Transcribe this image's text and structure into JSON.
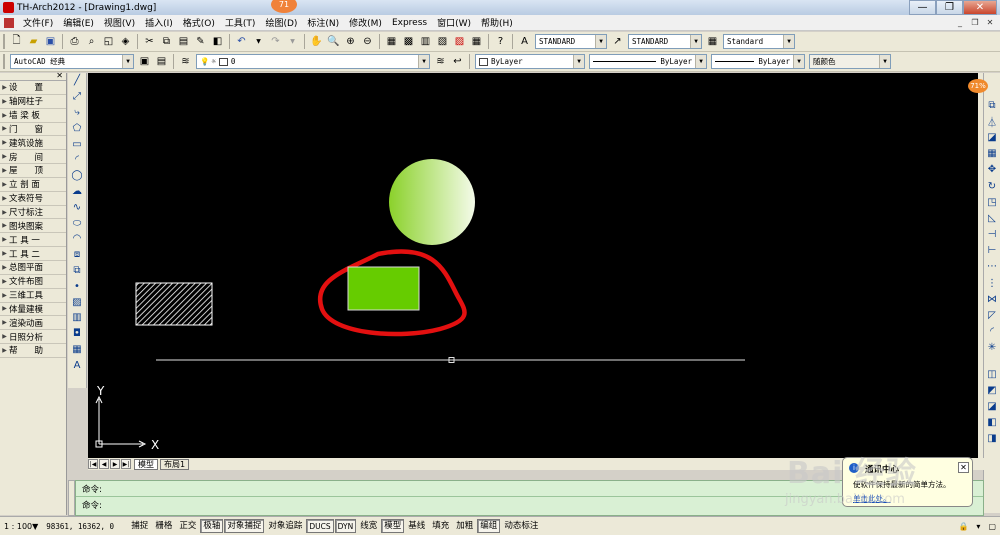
{
  "window": {
    "title": "TH-Arch2012 - [Drawing1.dwg]",
    "notify_count": "71",
    "minimize": "—",
    "maximize": "❐",
    "close": "✕"
  },
  "menu": [
    "文件(F)",
    "编辑(E)",
    "视图(V)",
    "插入(I)",
    "格式(O)",
    "工具(T)",
    "绘图(D)",
    "标注(N)",
    "修改(M)",
    "Express",
    "窗口(W)",
    "帮助(H)"
  ],
  "mdi": {
    "minimize": "_",
    "restore": "❐",
    "close": "✕"
  },
  "toolbar1": {
    "text_style": "STANDARD",
    "dim_style": "STANDARD",
    "table_style": "Standard"
  },
  "toolbar2": {
    "workspace": "AutoCAD 经典",
    "layer": "0",
    "color": "ByLayer",
    "linetype": "ByLayer",
    "lineweight": "ByLayer",
    "plotstyle": "随颜色"
  },
  "tarch_menu": [
    "设　　置",
    "轴网柱子",
    "墙 梁 板",
    "门　　窗",
    "建筑设施",
    "房　　间",
    "屋　　顶",
    "立 剖 面",
    "文表符号",
    "尺寸标注",
    "图块图案",
    "工 具 一",
    "工 具 二",
    "总图平面",
    "文件布图",
    "三维工具",
    "体量建模",
    "渲染动画",
    "日照分析",
    "帮　　助"
  ],
  "canvas": {
    "ucs_y": "Y",
    "ucs_x": "X",
    "colors": {
      "background": "#000000",
      "rect": "#66cc00",
      "annotation": "#e31010",
      "circle_light": "#f4fbe9",
      "circle_dark": "#8bd12b"
    }
  },
  "tabs": {
    "model": "模型",
    "layout": "布局1"
  },
  "command": {
    "line1": "命令:",
    "line2": "命令:"
  },
  "status": {
    "scale": "1 : 100",
    "coords": "98361,  16362, 0",
    "buttons": [
      {
        "label": "捕捉",
        "on": false
      },
      {
        "label": "栅格",
        "on": false
      },
      {
        "label": "正交",
        "on": false
      },
      {
        "label": "极轴",
        "on": true
      },
      {
        "label": "对象捕捉",
        "on": true
      },
      {
        "label": "对象追踪",
        "on": false
      },
      {
        "label": "DUCS",
        "on": true
      },
      {
        "label": "DYN",
        "on": true
      },
      {
        "label": "线宽",
        "on": false
      },
      {
        "label": "模型",
        "on": true
      },
      {
        "label": "基线",
        "on": false
      },
      {
        "label": "填充",
        "on": false
      },
      {
        "label": "加粗",
        "on": false
      },
      {
        "label": "编组",
        "on": true
      },
      {
        "label": "动态标注",
        "on": false
      }
    ]
  },
  "balloon": {
    "title": "通讯中心",
    "text": "使软件保持最新的简单方法。",
    "link": "单击此处。"
  },
  "side_badge": "71%",
  "watermark": {
    "brand": "Bai 经验",
    "url": "jingyan.baidu.com"
  }
}
